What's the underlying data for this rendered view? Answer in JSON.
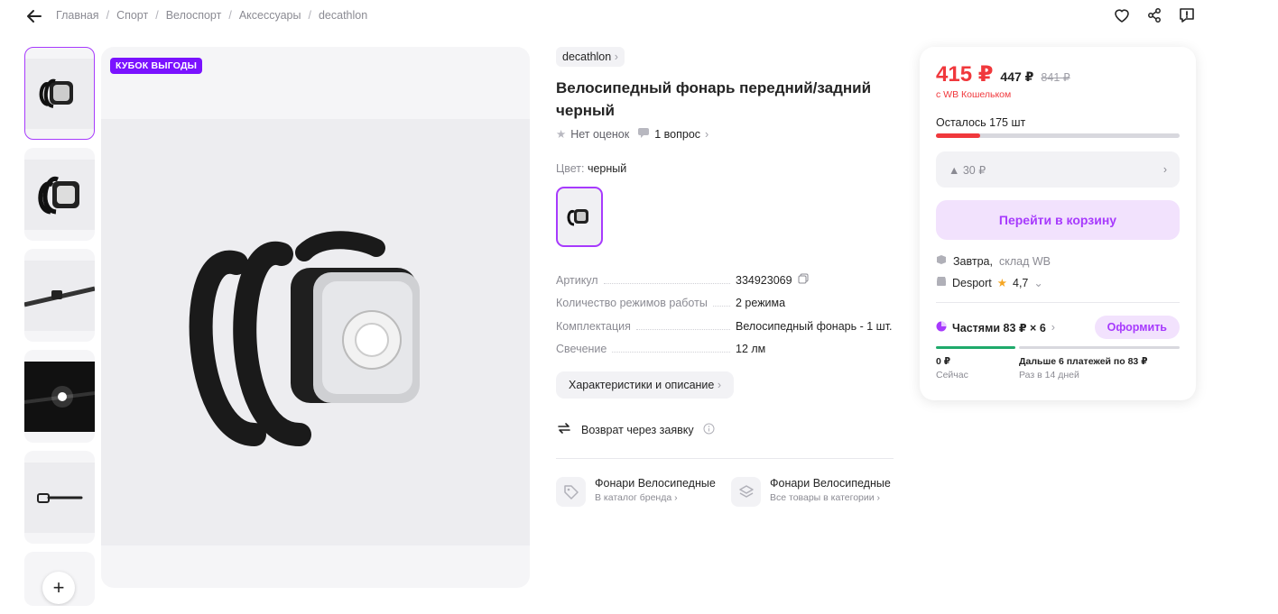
{
  "breadcrumbs": [
    "Главная",
    "Спорт",
    "Велоспорт",
    "Аксессуары",
    "decathlon"
  ],
  "badge": "КУБОК ВЫГОДЫ",
  "product": {
    "brand": "decathlon",
    "title_line1": "Велосипедный фонарь передний/задний",
    "title_line2": "черный",
    "rating_text": "Нет оценок",
    "questions_text": "1 вопрос",
    "color_label": "Цвет:",
    "color_value": "черный"
  },
  "specs": [
    {
      "key": "Артикул",
      "value": "334923069"
    },
    {
      "key": "Количество режимов работы",
      "value": "2 режима"
    },
    {
      "key": "Комплектация",
      "value": "Велосипедный фонарь - 1 шт."
    },
    {
      "key": "Свечение",
      "value": "12 лм"
    }
  ],
  "chars_button": "Характеристики и описание",
  "return_text": "Возврат через заявку",
  "categories": [
    {
      "title": "Фонари Велосипедные",
      "sub": "В каталог бренда"
    },
    {
      "title": "Фонари Велосипедные",
      "sub": "Все товары в категории"
    }
  ],
  "card": {
    "price": "415 ₽",
    "price_old": "447 ₽",
    "price_strike": "841 ₽",
    "wallet": "с WB Кошельком",
    "stock": "Осталось 175 шт",
    "stock_fill_percent": 18,
    "promo": "▲ 30 ₽",
    "cart_button": "Перейти в корзину",
    "delivery_day": "Завтра,",
    "delivery_wh": "склад WB",
    "seller": "Desport",
    "seller_rating": "4,7",
    "parts_label": "Частями 83 ₽ × 6",
    "order_button": "Оформить",
    "pay_now_amount": "0 ₽",
    "pay_now_label": "Сейчас",
    "pay_later_amount": "Дальше 6 платежей по 83 ₽",
    "pay_later_label": "Раз в 14 дней"
  },
  "colors": {
    "accent": "#a73afd",
    "price": "#f0383c",
    "badge": "#7a12ff",
    "green": "#1faa6b"
  }
}
